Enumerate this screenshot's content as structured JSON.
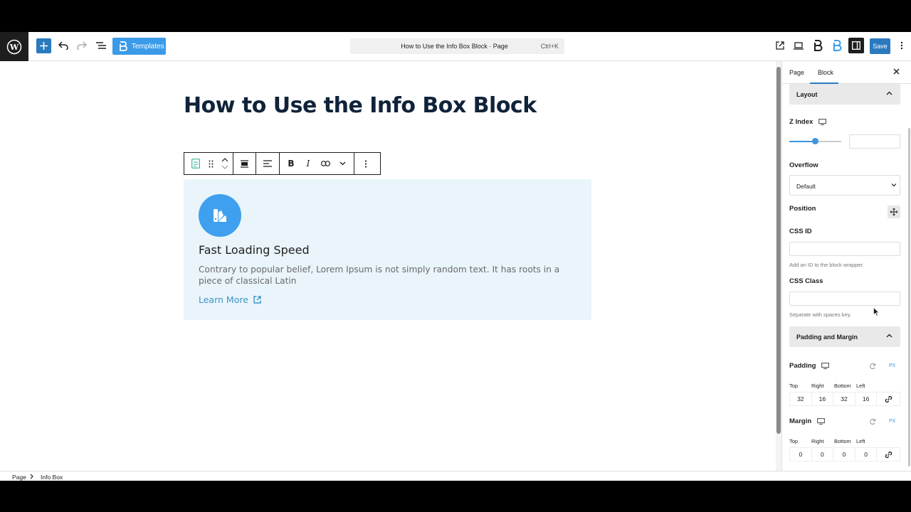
{
  "topbar": {
    "templates_label": "Templates",
    "document_title": "How to Use the Info Box Block · Page",
    "shortcut": "Ctrl+K",
    "save_label": "Save"
  },
  "post": {
    "title": "How to Use the Info Box Block"
  },
  "info_box": {
    "title": "Fast Loading Speed",
    "description": "Contrary to popular belief, Lorem Ipsum is not simply random text. It has roots in a piece of classical Latin",
    "link_label": "Learn More",
    "background": "#e9f5fb",
    "icon_color": "#3ea0ee"
  },
  "sidebar": {
    "tabs": [
      "Page",
      "Block"
    ],
    "active_tab": "Block",
    "layout_panel": "Layout",
    "z_index_label": "Z Index",
    "z_index_value": 0.5,
    "overflow_label": "Overflow",
    "overflow_value": "Default",
    "position_label": "Position",
    "css_id_label": "CSS ID",
    "css_id_help": "Add an ID to the block wrapper.",
    "css_class_label": "CSS Class",
    "css_class_help": "Separate with spaces key.",
    "padding_margin_panel": "Padding and Margin",
    "padding": {
      "label": "Padding",
      "unit": "PX",
      "sides": [
        "Top",
        "Right",
        "Bottom",
        "Left"
      ],
      "values": [
        "32",
        "16",
        "32",
        "16"
      ]
    },
    "margin": {
      "label": "Margin",
      "unit": "PX",
      "sides": [
        "Top",
        "Right",
        "Bottom",
        "Left"
      ],
      "values": [
        "0",
        "0",
        "0",
        "0"
      ]
    }
  },
  "breadcrumb": [
    "Page",
    "Info Box"
  ],
  "colors": {
    "accent": "#2a7abf",
    "templates_button": "#3b9be8",
    "title": "#10233a",
    "link": "#3b95c9"
  }
}
